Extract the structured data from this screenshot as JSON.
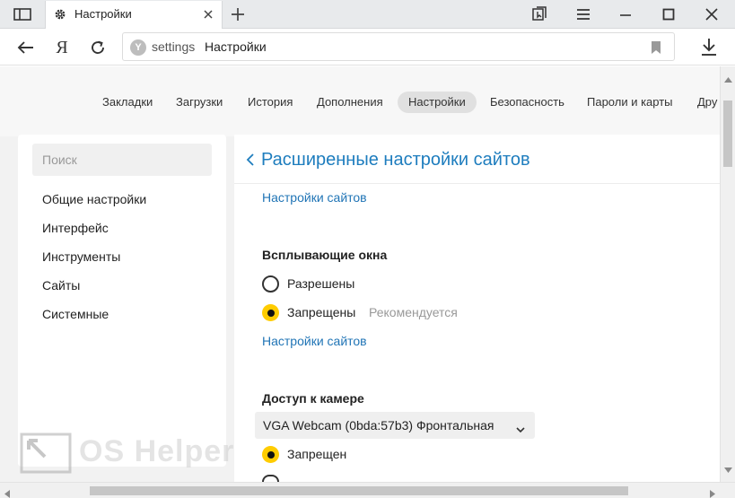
{
  "tab": {
    "title": "Настройки",
    "icon": "gear-icon"
  },
  "address": {
    "host": "settings",
    "page_title": "Настройки"
  },
  "nav": {
    "yandex_logo": "Я"
  },
  "topnav": {
    "items": [
      {
        "label": "Закладки",
        "active": false
      },
      {
        "label": "Загрузки",
        "active": false
      },
      {
        "label": "История",
        "active": false
      },
      {
        "label": "Дополнения",
        "active": false
      },
      {
        "label": "Настройки",
        "active": true
      },
      {
        "label": "Безопасность",
        "active": false
      },
      {
        "label": "Пароли и карты",
        "active": false
      },
      {
        "label": "Дру",
        "active": false
      }
    ]
  },
  "sidebar": {
    "search_placeholder": "Поиск",
    "items": [
      {
        "label": "Общие настройки"
      },
      {
        "label": "Интерфейс"
      },
      {
        "label": "Инструменты"
      },
      {
        "label": "Сайты"
      },
      {
        "label": "Системные"
      }
    ]
  },
  "content": {
    "title": "Расширенные настройки сайтов",
    "site_settings_link_top": "Настройки сайтов",
    "popups": {
      "title": "Всплывающие окна",
      "options": [
        {
          "label": "Разрешены",
          "selected": false
        },
        {
          "label": "Запрещены",
          "selected": true,
          "note": "Рекомендуется"
        }
      ],
      "link": "Настройки сайтов"
    },
    "camera": {
      "title": "Доступ к камере",
      "device": "VGA Webcam (0bda:57b3) Фронтальная",
      "options": [
        {
          "label": "Запрещен",
          "selected": true
        }
      ]
    }
  },
  "watermark": {
    "text": "OS Helper"
  },
  "colors": {
    "accent_yellow": "#ffcc00",
    "link_blue": "#2175b6",
    "title_blue": "#1e7dbe"
  }
}
